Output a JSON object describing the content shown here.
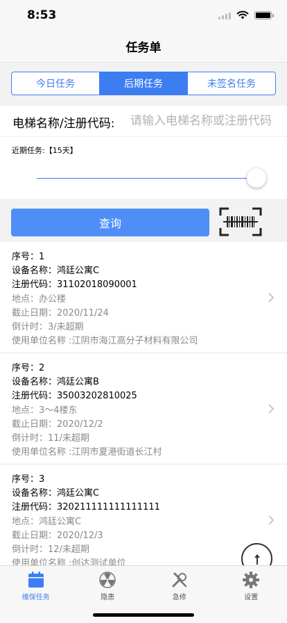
{
  "status_bar": {
    "time": "8:53"
  },
  "nav": {
    "title": "任务单"
  },
  "segments": [
    {
      "label": "今日任务",
      "active": false
    },
    {
      "label": "后期任务",
      "active": true
    },
    {
      "label": "未签名任务",
      "active": false
    }
  ],
  "search": {
    "label": "电梯名称/注册代码:",
    "placeholder": "请输入电梯名称或注册代码",
    "value": ""
  },
  "range": {
    "label": "近期任务:【15天】",
    "slider_fraction": 1.0
  },
  "query_button": {
    "label": "查询"
  },
  "icons": {
    "scan": "barcode-scan-icon",
    "chevron": "chevron-right-icon",
    "float": "arrow-up-circle-icon"
  },
  "colors": {
    "accent": "#3d7df2",
    "button": "#4f8ef7",
    "muted_text": "#8a8a8a"
  },
  "tasks": [
    {
      "seq": "序号：1",
      "name": "设备名称：鸿廷公寓C",
      "reg_code": "注册代码：31102018090001",
      "location": "地点：办公楼",
      "deadline": "截止日期：2020/11/24",
      "countdown": "倒计时：3/未超期",
      "unit": "使用单位名称 :江阴市海江高分子材料有限公司"
    },
    {
      "seq": "序号：2",
      "name": "设备名称：鸿廷公寓B",
      "reg_code": "注册代码：35003202810025",
      "location": "地点：3～4楼东",
      "deadline": "截止日期：2020/12/2",
      "countdown": "倒计时：11/未超期",
      "unit": "使用单位名称 :江阴市夏港街道长江村"
    },
    {
      "seq": "序号：3",
      "name": "设备名称：鸿廷公寓C",
      "reg_code": "注册代码：320211111111111111",
      "location": "地点：鸿廷公寓C",
      "deadline": "截止日期：2020/12/3",
      "countdown": "倒计时：12/未超期",
      "unit": "使用单位名称 :创达测试单位"
    }
  ],
  "tab_bar": [
    {
      "label": "维保任务",
      "icon": "calendar-icon",
      "active": true
    },
    {
      "label": "隐患",
      "icon": "hazard-icon",
      "active": false
    },
    {
      "label": "急修",
      "icon": "tools-icon",
      "active": false
    },
    {
      "label": "设置",
      "icon": "gear-icon",
      "active": false
    }
  ]
}
